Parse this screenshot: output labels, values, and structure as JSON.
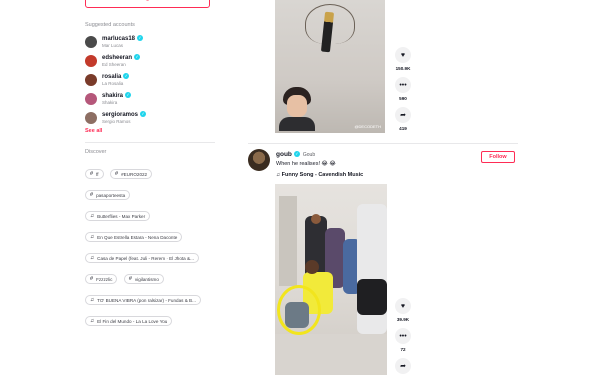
{
  "sidebar": {
    "login_label": "Log in",
    "suggested_title": "Suggested accounts",
    "accounts": [
      {
        "username": "marlucas18",
        "nickname": "Mar Lucas",
        "color": "#4a4a4a"
      },
      {
        "username": "edsheeran",
        "nickname": "Ed Sheeran",
        "color": "#c33a2b"
      },
      {
        "username": "rosalia",
        "nickname": "La Rosalia",
        "color": "#7a3b2a"
      },
      {
        "username": "shakira",
        "nickname": "Shakira",
        "color": "#b5577a"
      },
      {
        "username": "sergioramos",
        "nickname": "Sergio Ramos",
        "color": "#8d6e63"
      }
    ],
    "see_all": "See all",
    "discover_title": "Discover",
    "tags": [
      {
        "type": "hashtag",
        "label": "ff"
      },
      {
        "type": "hashtag",
        "label": "#EURO2022"
      },
      {
        "type": "hashtag",
        "label": "pasaporteesta"
      },
      {
        "type": "music",
        "label": "Butterflies - Max Parker"
      },
      {
        "type": "music",
        "label": "En Que Estrella Estara - Nena Daconte"
      },
      {
        "type": "music",
        "label": "Casa de Papel (feat. Juli - Rerem · El Jhota &..."
      },
      {
        "type": "hashtag",
        "label": "Fzzzzlic"
      },
      {
        "type": "hashtag",
        "label": "vigilantismo"
      },
      {
        "type": "music",
        "label": "TO' BUENA VIBRA (pon ralsizar) - Fundas & B..."
      },
      {
        "type": "music",
        "label": "El Fin del Mundo - La La Love You"
      }
    ]
  },
  "feed": {
    "post1": {
      "watermark": "@DECODETH",
      "likes": "150.9K",
      "comments": "590",
      "shares": "419"
    },
    "post2": {
      "username": "goub",
      "nickname": "Goub",
      "description": "When he realises! 😂 😂",
      "music": "Funny Song - Cavendish Music",
      "follow_label": "Follow",
      "likes": "39.9K",
      "comments": "72"
    }
  },
  "colors": {
    "accent": "#fe2c55",
    "verified": "#20d5ec",
    "annotation": "#f2e51d"
  },
  "icons": {
    "like": "heart-icon",
    "comment": "comment-icon",
    "share": "share-icon",
    "hashtag": "hashtag-icon",
    "music": "music-note-icon"
  }
}
